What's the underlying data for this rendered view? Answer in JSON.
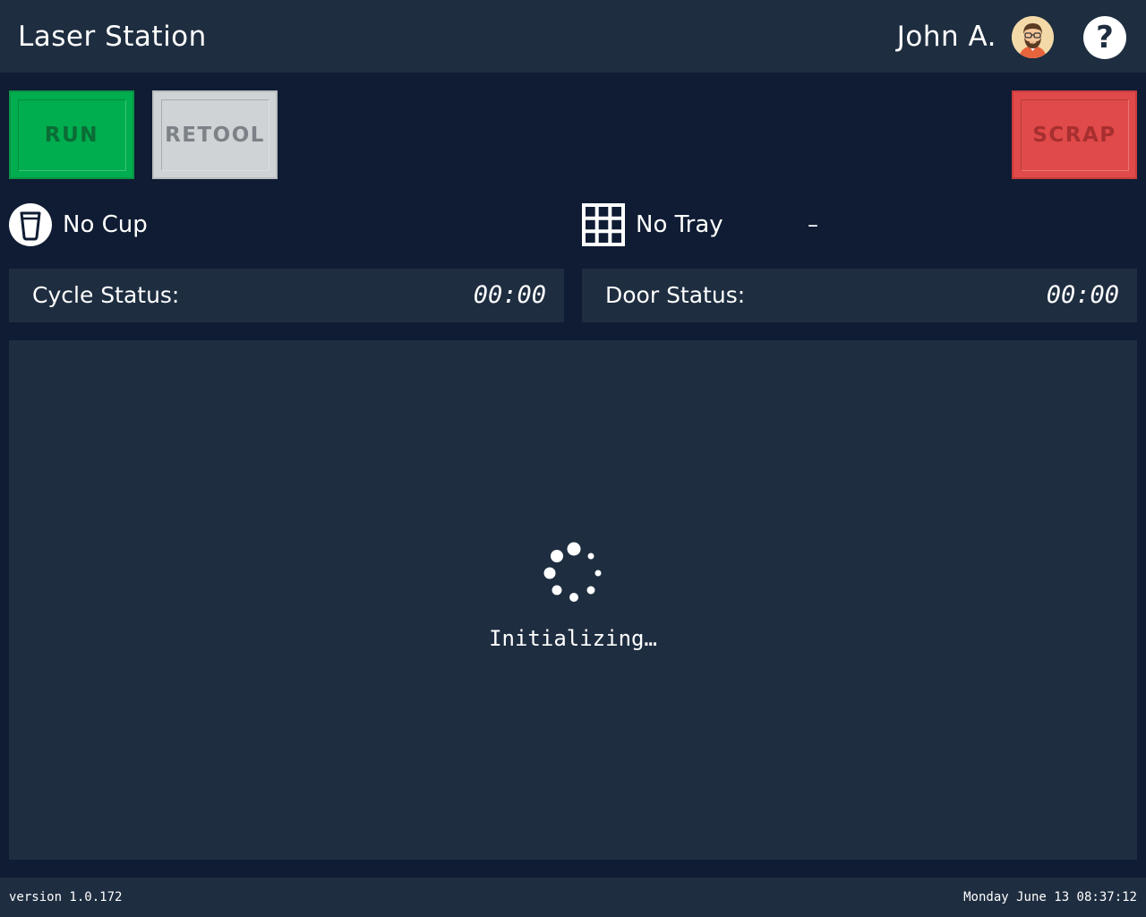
{
  "header": {
    "title": "Laser Station",
    "user_name": "John A.",
    "avatar_icon": "bearded-man-avatar",
    "help_icon": "question-mark-icon",
    "help_label": "?"
  },
  "actions": {
    "run_label": "RUN",
    "retool_label": "RETOOL",
    "scrap_label": "SCRAP"
  },
  "indicators": {
    "cup": {
      "icon": "cup-icon",
      "label": "No Cup"
    },
    "tray": {
      "icon": "grid-tray-icon",
      "label": "No Tray",
      "value": "–"
    }
  },
  "status": {
    "cycle": {
      "label": "Cycle Status:",
      "time": "00:00"
    },
    "door": {
      "label": "Door Status:",
      "time": "00:00"
    }
  },
  "main": {
    "spinner_icon": "loading-spinner-icon",
    "loading_text": "Initializing…"
  },
  "footer": {
    "version": "version 1.0.172",
    "datetime": "Monday June 13 08:37:12"
  },
  "colors": {
    "background": "#0f1c33",
    "panel": "#1e2d40",
    "run": "#00ad4f",
    "retool": "#cfd3d6",
    "scrap": "#e14a4a"
  }
}
